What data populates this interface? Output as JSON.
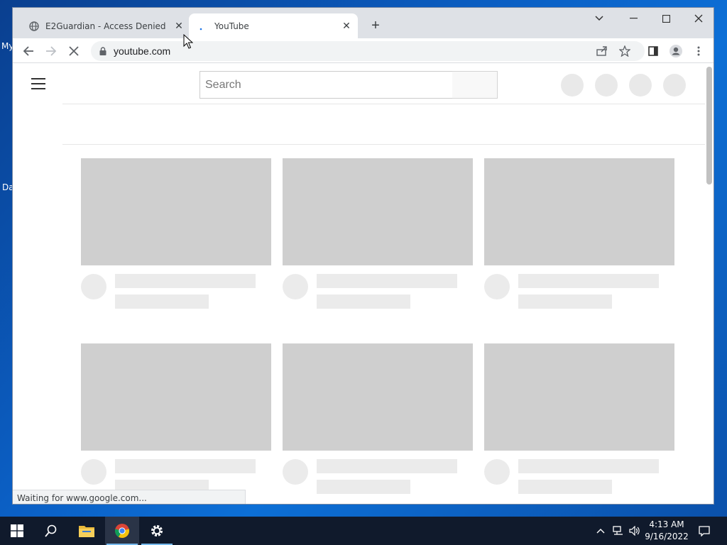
{
  "desktop": {
    "fragments": [
      "My",
      "Da"
    ]
  },
  "browser": {
    "tabs": [
      {
        "title": "E2Guardian - Access Denied",
        "favicon": "globe-icon",
        "active": false
      },
      {
        "title": "YouTube",
        "favicon": "loading-spinner-icon",
        "active": true
      }
    ],
    "url": "youtube.com",
    "status_text": "Waiting for www.google.com..."
  },
  "youtube": {
    "search_placeholder": "Search"
  },
  "taskbar": {
    "items": [
      "start-icon",
      "search-icon",
      "file-explorer-icon",
      "chrome-icon",
      "settings-icon"
    ],
    "clock_time": "4:13 AM",
    "clock_date": "9/16/2022"
  },
  "colors": {
    "skeleton": "#cfcfcf",
    "skeleton_light": "#ebebeb",
    "taskbar": "#101a2c",
    "desktop": "#0b5fc4"
  }
}
